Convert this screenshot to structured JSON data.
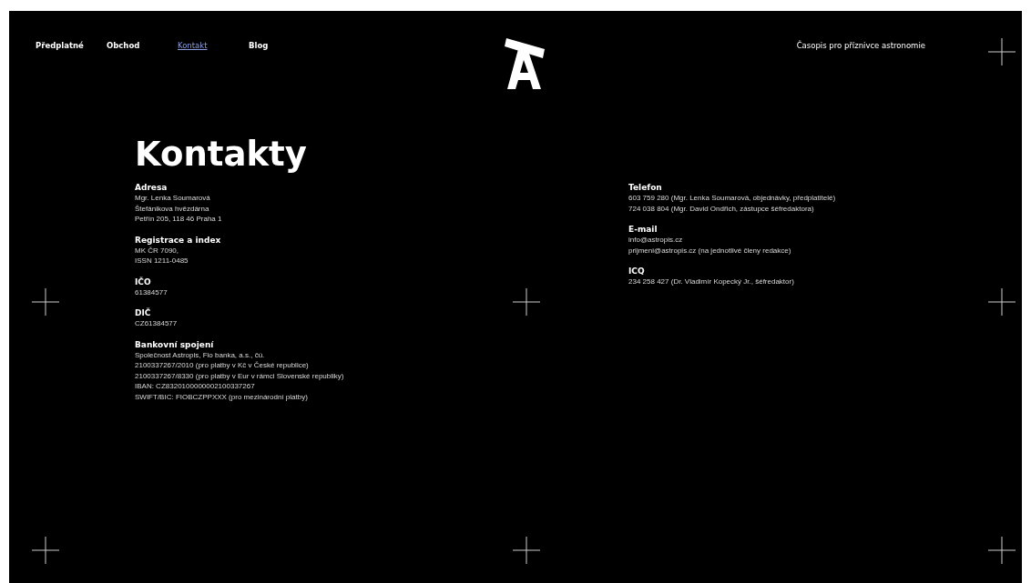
{
  "nav": [
    {
      "label": "Předplatné",
      "selected": false
    },
    {
      "label": "Obchod",
      "selected": false
    },
    {
      "label": "Kontakt",
      "selected": true
    },
    {
      "label": "Blog",
      "selected": false
    }
  ],
  "tagline": "Časopis pro příznivce astronomie",
  "title": "Kontakty",
  "columns": [
    [
      {
        "heading": "Adresa",
        "lines": [
          "Mgr. Lenka Soumarová",
          "Štefánikova hvězdárna",
          "Petřín 205, 118 46 Praha 1"
        ]
      },
      {
        "heading": "Registrace a index",
        "lines": [
          "MK ČR 7090,",
          "ISSN 1211-0485"
        ]
      },
      {
        "heading": "IČO",
        "lines": [
          "61384577"
        ]
      },
      {
        "heading": "DIČ",
        "lines": [
          "CZ61384577"
        ]
      },
      {
        "heading": "Bankovní spojení",
        "lines": [
          "Společnost Astropis, Fio banka, a.s., čú.",
          "2100337267/2010 (pro platby v Kč v České republice)",
          "2100337267/8330 (pro platby v Eur v rámci Slovenské republiky)",
          "IBAN: CZ8320100000002100337267",
          "SWIFT/BIC: FIOBCZPPXXX (pro mezinárodní platby)"
        ]
      }
    ],
    [
      {
        "heading": "Telefon",
        "lines": [
          "603 759 280 (Mgr. Lenka Soumarová, objednávky, předplatitelé)",
          "724 038 804 (Mgr. David Ondřich, zástupce šéfredaktora)"
        ]
      },
      {
        "heading": "E-mail",
        "lines": [
          "info@astropis.cz",
          "prijmeni@astropis.cz (na jednotlivé členy redakce)"
        ]
      },
      {
        "heading": "ICQ",
        "lines": [
          "234 258 427 (Dr. Vladimír Kopecký Jr., šéfredaktor)"
        ]
      }
    ]
  ]
}
